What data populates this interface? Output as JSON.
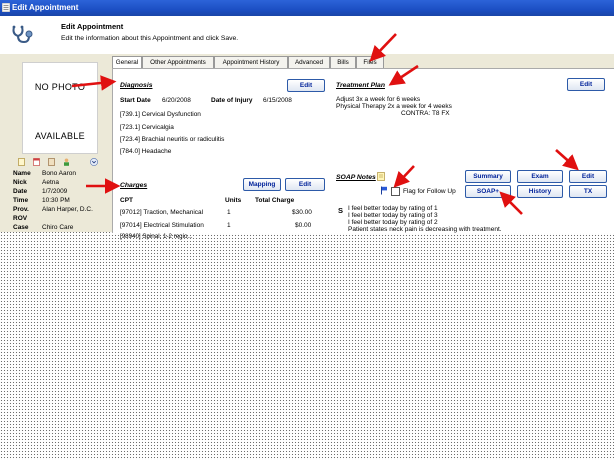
{
  "window": {
    "title": "Edit Appointment"
  },
  "header": {
    "title": "Edit Appointment",
    "subtitle": "Edit the information about this Appointment and click Save."
  },
  "photo": {
    "line1": "NO PHOTO",
    "line2": "AVAILABLE"
  },
  "patient": {
    "rows": [
      {
        "label": "Name",
        "value": "Bono Aaron"
      },
      {
        "label": "Nick",
        "value": "Aetna"
      },
      {
        "label": "Date",
        "value": "1/7/2009"
      },
      {
        "label": "Time",
        "value": "10:30 PM"
      },
      {
        "label": "Prov.",
        "value": "Alan Harper, D.C."
      },
      {
        "label": "ROV",
        "value": ""
      },
      {
        "label": "Case",
        "value": "Chiro Care"
      }
    ]
  },
  "tabs": [
    {
      "label": "General"
    },
    {
      "label": "Other Appointments"
    },
    {
      "label": "Appointment History"
    },
    {
      "label": "Advanced"
    },
    {
      "label": "Bills"
    },
    {
      "label": "Files"
    }
  ],
  "diagnosis": {
    "title": "Diagnosis",
    "edit_label": "Edit",
    "start_date_label": "Start Date",
    "start_date": "6/20/2008",
    "injury_label": "Date of Injury",
    "injury_date": "6/15/2008",
    "codes": [
      "[739.1] Cervical Dysfunction",
      "[723.1] Cervicalgia",
      "[723.4] Brachial neuritis or radiculitis",
      "[784.0] Headache"
    ]
  },
  "treatment": {
    "title": "Treatment Plan",
    "edit_label": "Edit",
    "lines": [
      "Adjust 3x a week for 6 weeks",
      "Physical Therapy 2x a week for 4 weeks"
    ],
    "contra": "CONTRA:  T8 FX"
  },
  "charges": {
    "title": "Charges",
    "mapping_label": "Mapping",
    "edit_label": "Edit",
    "columns": [
      "CPT",
      "Units",
      "Total Charge"
    ],
    "rows": [
      {
        "cpt": "[97012] Traction, Mechanical",
        "units": "1",
        "total": "$30.00"
      },
      {
        "cpt": "[97014] Electrical Stimulation",
        "units": "1",
        "total": "$0.00"
      },
      {
        "cpt": "[98940] Spinal, 1-2 regio...",
        "units": "",
        "total": ""
      }
    ]
  },
  "soap": {
    "title": "SOAP Notes",
    "flag_label": "Flag for Follow Up",
    "buttons": {
      "summary": "Summary",
      "exam": "Exam",
      "edit": "Edit",
      "soap_plus": "SOAP+",
      "history": "History",
      "tx": "TX"
    },
    "s_label": "S",
    "notes": [
      "I feel better today by rating of 1",
      "I feel better today by rating of 3",
      "I feel better today by rating of 2",
      "Patient states neck pain is decreasing with treatment."
    ]
  },
  "colors": {
    "arrow": "#e01010",
    "button_text": "#00229a",
    "titlebar": "#2c63d8"
  }
}
